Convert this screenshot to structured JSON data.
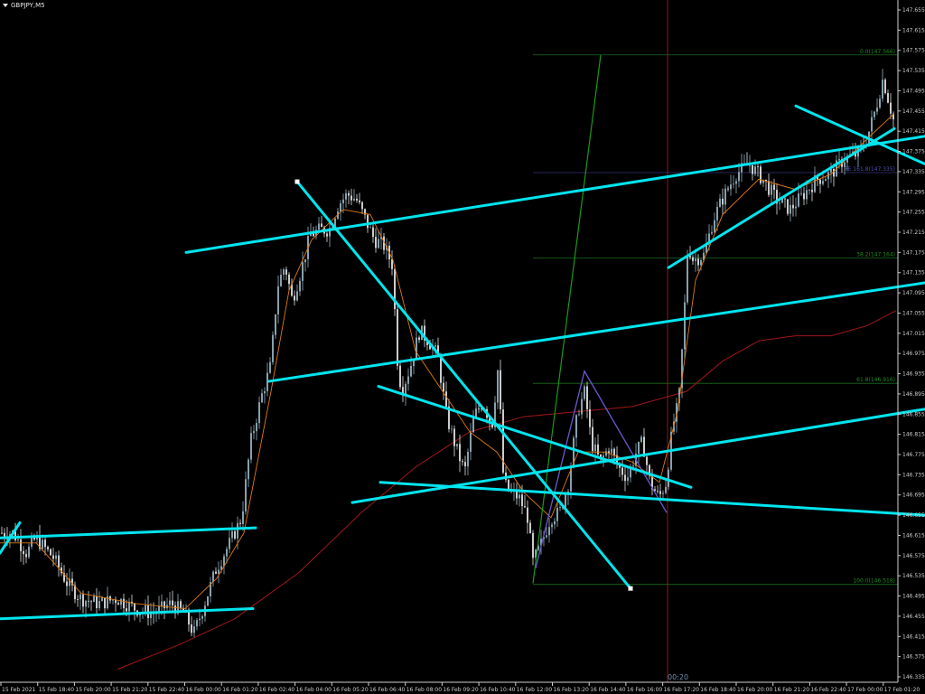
{
  "window": {
    "symbol_label": "GBPJPY,M5"
  },
  "colors": {
    "background": "#000000",
    "axis": "#cfcfcf",
    "bull_candle": "#a8c8d8",
    "bear_candle": "#ffffff",
    "orange_ma": "#e07a10",
    "red_ma": "#a01818",
    "trendlines": "#00e5ee",
    "fibo_level": "#1c6b1c",
    "fibo_text": "#1f8a1f",
    "fibo_ext": "#34347a",
    "green_ray": "#1a9a1a",
    "zigzag": "#6a5acd",
    "vline": "#8b1a1a"
  },
  "chart_data": {
    "type": "candlestick",
    "symbol": "GBPJPY",
    "timeframe": "M5",
    "ylim": [
      146.335,
      147.655
    ],
    "y_ticks": [
      "147.655",
      "147.615",
      "147.575",
      "147.535",
      "147.495",
      "147.455",
      "147.415",
      "147.375",
      "147.335",
      "147.295",
      "147.255",
      "147.215",
      "147.175",
      "147.135",
      "147.095",
      "147.055",
      "147.015",
      "146.975",
      "146.935",
      "146.895",
      "146.855",
      "146.815",
      "146.775",
      "146.735",
      "146.695",
      "146.655",
      "146.615",
      "146.575",
      "146.535",
      "146.495",
      "146.455",
      "146.415",
      "146.375",
      "146.335"
    ],
    "x_ticks": [
      "15 Feb 2021",
      "15 Feb 18:40",
      "15 Feb 20:00",
      "15 Feb 21:20",
      "15 Feb 22:40",
      "16 Feb 00:00",
      "16 Feb 01:20",
      "16 Feb 02:40",
      "16 Feb 04:00",
      "16 Feb 05:20",
      "16 Feb 06:40",
      "16 Feb 08:00",
      "16 Feb 09:20",
      "16 Feb 10:40",
      "16 Feb 12:00",
      "16 Feb 13:20",
      "16 Feb 14:40",
      "16 Feb 16:00",
      "16 Feb 17:20",
      "16 Feb 18:40",
      "16 Feb 20:00",
      "16 Feb 21:20",
      "16 Feb 22:40",
      "17 Feb 00:00",
      "17 Feb 01:20"
    ],
    "price_path": [
      [
        0,
        146.62
      ],
      [
        15,
        146.62
      ],
      [
        30,
        146.58
      ],
      [
        40,
        146.61
      ],
      [
        50,
        146.59
      ],
      [
        60,
        146.57
      ],
      [
        75,
        146.52
      ],
      [
        90,
        146.49
      ],
      [
        110,
        146.48
      ],
      [
        130,
        146.49
      ],
      [
        150,
        146.47
      ],
      [
        170,
        146.46
      ],
      [
        190,
        146.48
      ],
      [
        205,
        146.46
      ],
      [
        215,
        146.42
      ],
      [
        225,
        146.47
      ],
      [
        240,
        146.55
      ],
      [
        255,
        146.6
      ],
      [
        268,
        146.65
      ],
      [
        278,
        146.8
      ],
      [
        290,
        146.89
      ],
      [
        300,
        146.95
      ],
      [
        308,
        147.11
      ],
      [
        316,
        147.15
      ],
      [
        324,
        147.08
      ],
      [
        334,
        147.14
      ],
      [
        344,
        147.21
      ],
      [
        355,
        147.22
      ],
      [
        365,
        147.22
      ],
      [
        375,
        147.27
      ],
      [
        385,
        147.29
      ],
      [
        395,
        147.28
      ],
      [
        405,
        147.24
      ],
      [
        415,
        147.2
      ],
      [
        425,
        147.19
      ],
      [
        435,
        147.15
      ],
      [
        440,
        146.97
      ],
      [
        445,
        146.9
      ],
      [
        455,
        146.95
      ],
      [
        465,
        147.02
      ],
      [
        475,
        147.0
      ],
      [
        485,
        146.97
      ],
      [
        495,
        146.85
      ],
      [
        505,
        146.79
      ],
      [
        515,
        146.74
      ],
      [
        525,
        146.85
      ],
      [
        535,
        146.88
      ],
      [
        545,
        146.83
      ],
      [
        552,
        146.95
      ],
      [
        558,
        146.72
      ],
      [
        565,
        146.7
      ],
      [
        575,
        146.69
      ],
      [
        585,
        146.65
      ],
      [
        590,
        146.56
      ],
      [
        600,
        146.6
      ],
      [
        610,
        146.65
      ],
      [
        620,
        146.66
      ],
      [
        630,
        146.72
      ],
      [
        640,
        146.86
      ],
      [
        648,
        146.9
      ],
      [
        655,
        146.8
      ],
      [
        665,
        146.76
      ],
      [
        675,
        146.79
      ],
      [
        685,
        146.75
      ],
      [
        695,
        146.73
      ],
      [
        705,
        146.78
      ],
      [
        712,
        146.8
      ],
      [
        720,
        146.72
      ],
      [
        730,
        146.69
      ],
      [
        738,
        146.72
      ],
      [
        745,
        146.83
      ],
      [
        752,
        146.88
      ],
      [
        757,
        147.02
      ],
      [
        762,
        147.19
      ],
      [
        768,
        147.16
      ],
      [
        780,
        147.17
      ],
      [
        790,
        147.24
      ],
      [
        800,
        147.28
      ],
      [
        815,
        147.33
      ],
      [
        830,
        147.35
      ],
      [
        845,
        147.32
      ],
      [
        860,
        147.28
      ],
      [
        875,
        147.26
      ],
      [
        890,
        147.29
      ],
      [
        905,
        147.32
      ],
      [
        920,
        147.33
      ],
      [
        935,
        147.36
      ],
      [
        950,
        147.37
      ],
      [
        960,
        147.4
      ],
      [
        970,
        147.46
      ],
      [
        978,
        147.52
      ],
      [
        985,
        147.47
      ],
      [
        992,
        147.42
      ]
    ],
    "orange_ma_path": [
      [
        0,
        146.6
      ],
      [
        40,
        146.6
      ],
      [
        90,
        146.5
      ],
      [
        150,
        146.48
      ],
      [
        205,
        146.47
      ],
      [
        240,
        146.53
      ],
      [
        270,
        146.62
      ],
      [
        300,
        146.9
      ],
      [
        320,
        147.1
      ],
      [
        345,
        147.2
      ],
      [
        380,
        147.26
      ],
      [
        410,
        147.25
      ],
      [
        435,
        147.16
      ],
      [
        460,
        146.98
      ],
      [
        490,
        146.9
      ],
      [
        520,
        146.82
      ],
      [
        550,
        146.78
      ],
      [
        580,
        146.7
      ],
      [
        610,
        146.65
      ],
      [
        640,
        146.78
      ],
      [
        670,
        146.78
      ],
      [
        700,
        146.76
      ],
      [
        730,
        146.72
      ],
      [
        750,
        146.86
      ],
      [
        770,
        147.12
      ],
      [
        800,
        147.25
      ],
      [
        840,
        147.32
      ],
      [
        880,
        147.3
      ],
      [
        920,
        147.33
      ],
      [
        960,
        147.4
      ],
      [
        990,
        147.45
      ]
    ],
    "red_ma_path": [
      [
        130,
        146.35
      ],
      [
        200,
        146.4
      ],
      [
        260,
        146.45
      ],
      [
        330,
        146.54
      ],
      [
        400,
        146.66
      ],
      [
        460,
        146.75
      ],
      [
        520,
        146.82
      ],
      [
        580,
        146.85
      ],
      [
        640,
        146.86
      ],
      [
        700,
        146.87
      ],
      [
        760,
        146.9
      ],
      [
        800,
        146.96
      ],
      [
        840,
        147.0
      ],
      [
        880,
        147.01
      ],
      [
        920,
        147.01
      ],
      [
        960,
        147.03
      ],
      [
        992,
        147.06
      ]
    ],
    "trendlines": [
      [
        [
          0,
          146.58
        ],
        [
          22,
          146.64
        ]
      ],
      [
        [
          0,
          146.61
        ],
        [
          283,
          146.63
        ]
      ],
      [
        [
          0,
          146.45
        ],
        [
          280,
          146.47
        ]
      ],
      [
        [
          206,
          147.175
        ],
        [
          1024,
          147.405
        ]
      ],
      [
        [
          298,
          146.92
        ],
        [
          1024,
          147.115
        ]
      ],
      [
        [
          329,
          147.315
        ],
        [
          698,
          146.51
        ]
      ],
      [
        [
          419,
          146.91
        ],
        [
          765,
          146.71
        ]
      ],
      [
        [
          421,
          146.72
        ],
        [
          1024,
          146.655
        ]
      ],
      [
        [
          390,
          146.68
        ],
        [
          1024,
          146.865
        ]
      ],
      [
        [
          740,
          147.145
        ],
        [
          990,
          147.42
        ]
      ],
      [
        [
          881,
          147.465
        ],
        [
          1024,
          147.35
        ]
      ]
    ],
    "fibo": {
      "levels": [
        {
          "label": "0.0(147.566)",
          "price": 147.566
        },
        {
          "label": "38.2(147.164)",
          "price": 147.164
        },
        {
          "label": "61.8(146.916)",
          "price": 146.916
        },
        {
          "label": "100.0(146.518)",
          "price": 146.518
        }
      ],
      "extension": {
        "label": "FE 161.8(147.335)",
        "price": 147.333
      }
    },
    "green_ray": [
      [
        590,
        146.52
      ],
      [
        665,
        147.566
      ]
    ],
    "zigzag": [
      [
        593,
        146.55
      ],
      [
        647,
        146.94
      ],
      [
        738,
        146.66
      ]
    ],
    "time_marker": {
      "label": "00:20"
    }
  }
}
